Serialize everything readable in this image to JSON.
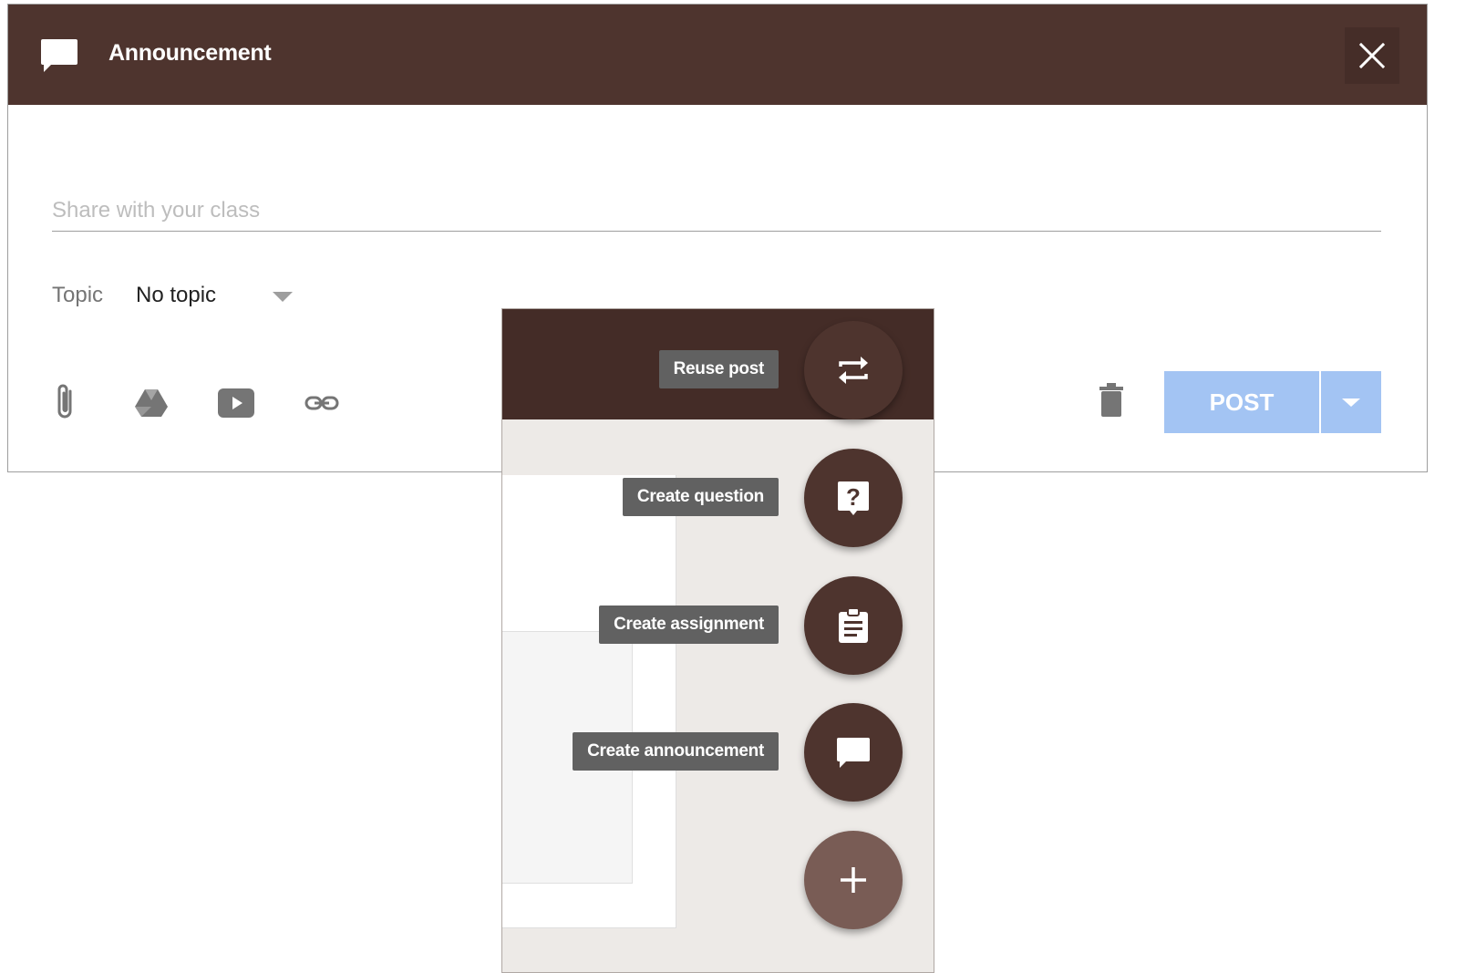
{
  "dialog": {
    "title": "Announcement",
    "share_placeholder": "Share with your class",
    "share_value": "",
    "topic_label": "Topic",
    "topic_value": "No topic",
    "post_label": "POST",
    "header_color": "#4e342e",
    "post_color": "#a3c4f3",
    "icons": [
      "announcement-icon",
      "close-icon",
      "attachment-icon",
      "google-drive-icon",
      "youtube-icon",
      "link-icon",
      "trash-icon",
      "dropdown-icon"
    ]
  },
  "fab_menu": {
    "items": [
      {
        "label": "Reuse post",
        "icon": "reuse-icon"
      },
      {
        "label": "Create question",
        "icon": "question-icon"
      },
      {
        "label": "Create assignment",
        "icon": "assignment-icon"
      },
      {
        "label": "Create announcement",
        "icon": "announcement-icon"
      }
    ],
    "main_icon": "plus-icon",
    "fab_color": "#4e342e",
    "tooltip_color": "#616161"
  }
}
